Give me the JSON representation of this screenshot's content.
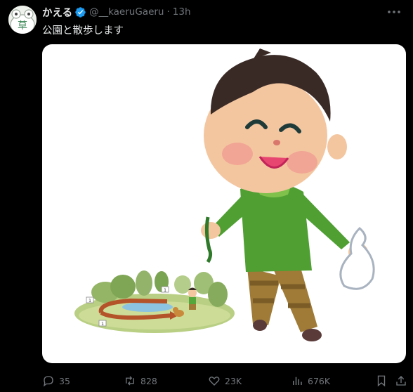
{
  "post": {
    "author": {
      "display_name": "かえる",
      "handle": "@__kaeruGaeru",
      "separator": "·",
      "time": "13h",
      "avatar_glyph": "草",
      "verified_icon": "verified-badge-icon"
    },
    "text": "公園と散歩します",
    "media": {
      "description_icon": "illustration-boy-walking-dog",
      "map_labels": [
        "1",
        "1",
        "1"
      ]
    },
    "actions": {
      "replies": "35",
      "reposts": "828",
      "likes": "23K",
      "views": "676K"
    }
  },
  "colors": {
    "background": "#000000",
    "text": "#e7e9ea",
    "secondary": "#71767b",
    "verified": "#1d9bf0"
  }
}
